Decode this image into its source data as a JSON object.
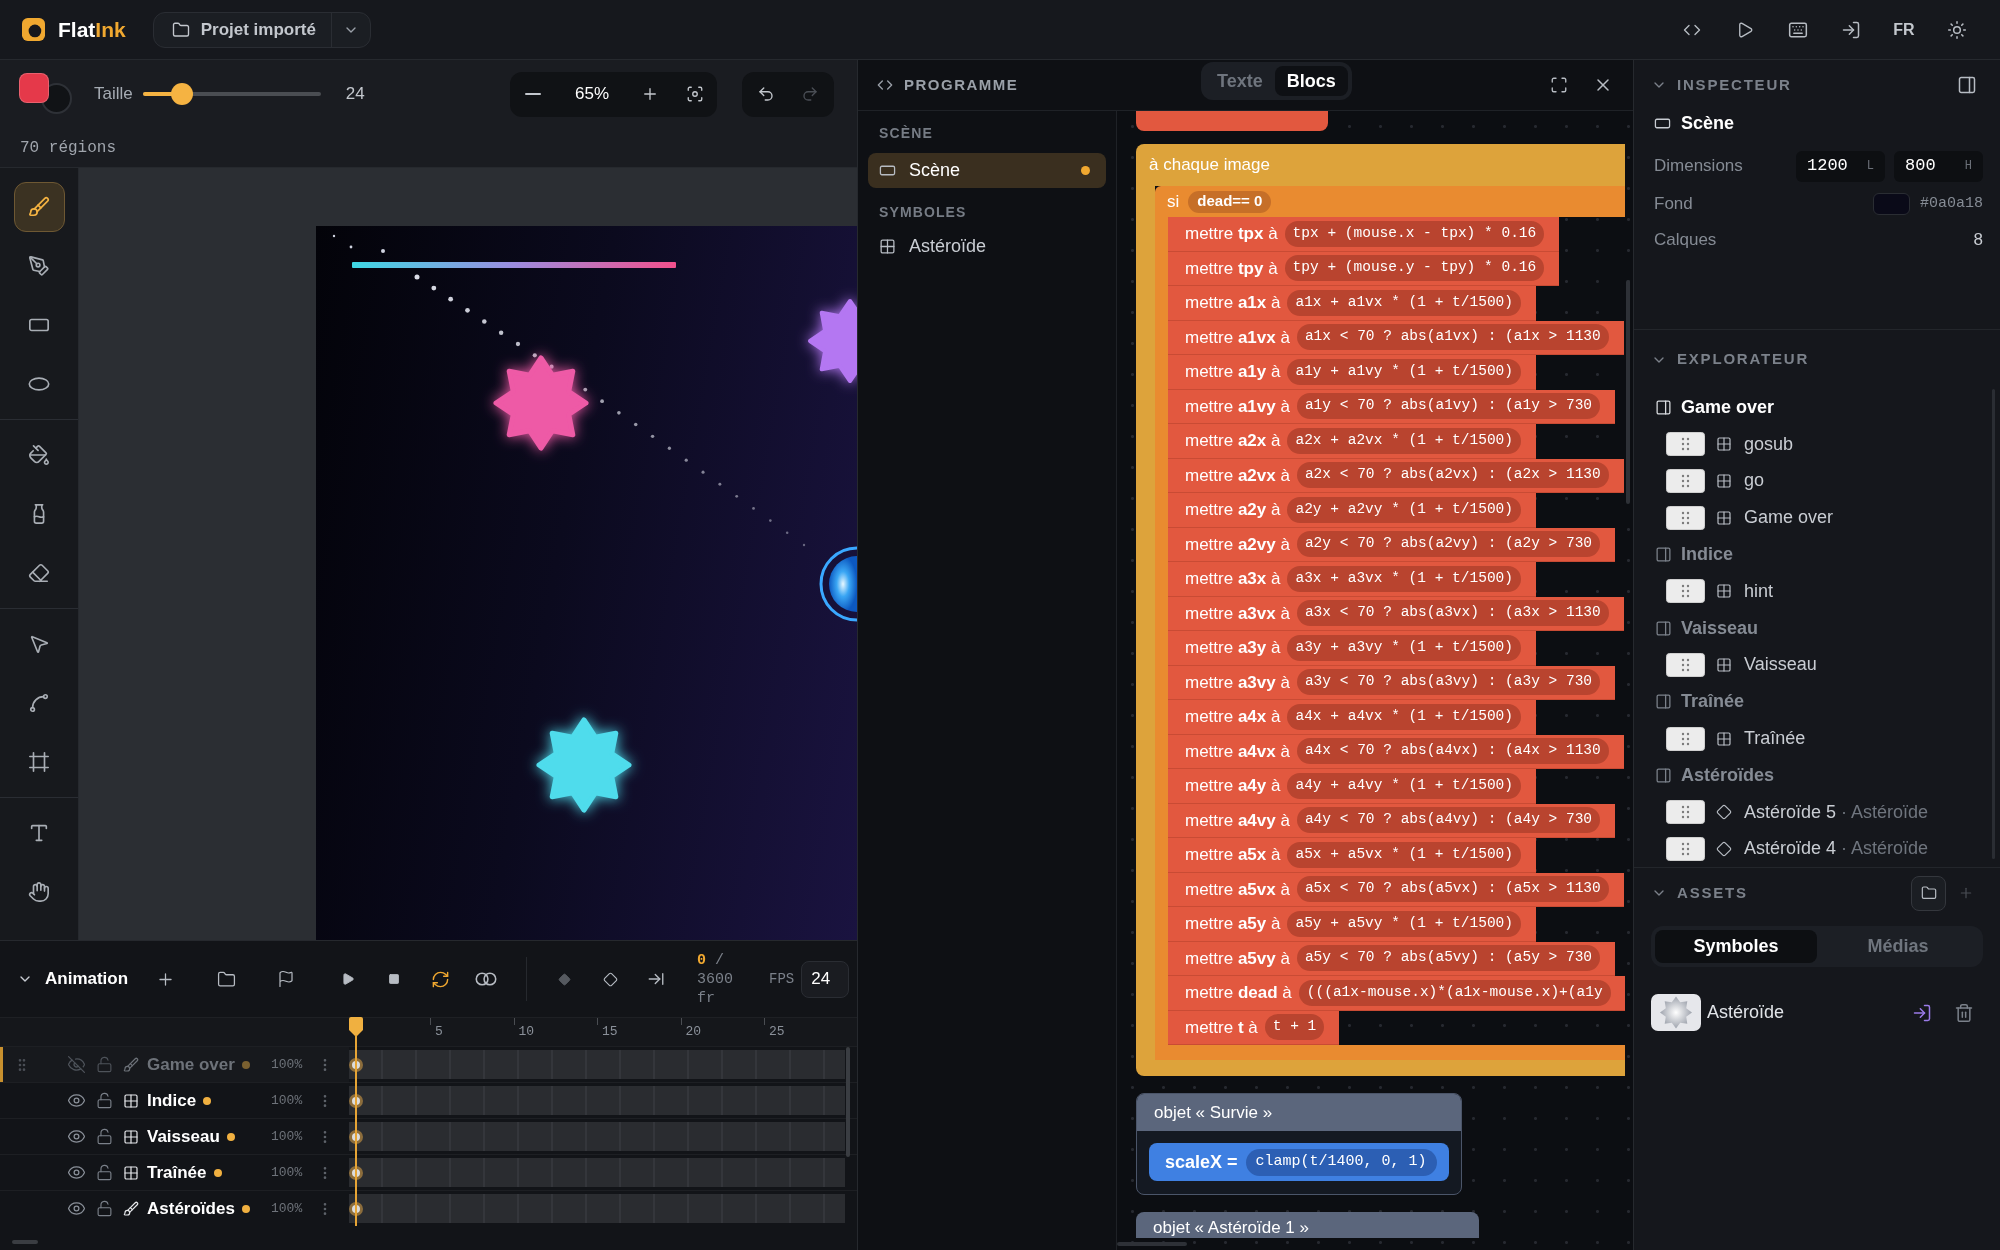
{
  "header": {
    "logo": {
      "text_1": "Flat",
      "text_2": "Ink"
    },
    "project": "Projet importé",
    "language": "FR"
  },
  "toolbar": {
    "color": "#e5394a",
    "size_label": "Taille",
    "size": {
      "level": 0.22
    },
    "size_value": "24",
    "zoom": "65%",
    "redo_disabled": true
  },
  "status": "70 régions",
  "tool_groups": [
    {
      "tools": [
        {
          "kind": "brush",
          "selected": true
        },
        {
          "kind": "pen",
          "selected": false
        },
        {
          "kind": "rectangle",
          "selected": false
        },
        {
          "kind": "ellipse",
          "selected": false
        }
      ]
    },
    {
      "tools": [
        {
          "kind": "bucket",
          "selected": false
        },
        {
          "kind": "bottle",
          "selected": false
        },
        {
          "kind": "eraser",
          "selected": false
        }
      ]
    },
    {
      "tools": [
        {
          "kind": "pointer",
          "selected": false
        },
        {
          "kind": "node",
          "selected": false
        },
        {
          "kind": "frame",
          "selected": false
        }
      ]
    },
    {
      "tools": [
        {
          "kind": "text",
          "selected": false
        },
        {
          "kind": "hand",
          "selected": false
        }
      ]
    }
  ],
  "timeline": {
    "title": "Animation",
    "loop": true,
    "frame": "0",
    "frame_total": "/ 3600 fr",
    "fps_label": "FPS",
    "fps": "24",
    "ruler": [
      "5",
      "10",
      "15",
      "20",
      "25"
    ],
    "layers": [
      {
        "name": "Game over",
        "kind": "brush",
        "visible": false,
        "selected": true,
        "opacity": "100%"
      },
      {
        "name": "Indice",
        "kind": "symbol",
        "visible": true,
        "selected": false,
        "opacity": "100%"
      },
      {
        "name": "Vaisseau",
        "kind": "symbol",
        "visible": true,
        "selected": false,
        "opacity": "100%"
      },
      {
        "name": "Traînée",
        "kind": "symbol",
        "visible": true,
        "selected": false,
        "opacity": "100%"
      },
      {
        "name": "Astéroïdes",
        "kind": "brush",
        "visible": true,
        "selected": false,
        "opacity": "100%"
      }
    ]
  },
  "program": {
    "title": "PROGRAMME",
    "tabs": [
      {
        "label": "Texte",
        "selected": false
      },
      {
        "label": "Blocs",
        "selected": true
      }
    ],
    "sections": [
      {
        "heading": "SCÈNE",
        "items": [
          {
            "label": "Scène",
            "kind": "scene",
            "selected": true,
            "modified": true
          }
        ]
      },
      {
        "heading": "SYMBOLES",
        "items": [
          {
            "label": "Astéroïde",
            "kind": "symbol",
            "selected": false,
            "modified": false
          }
        ]
      }
    ],
    "event": {
      "label": "à chaque image",
      "condition": {
        "label": "si",
        "expression": "dead== 0",
        "statements": [
          {
            "label": "mettre **tpx** à",
            "expression": "tpx + (mouse.x - tpx) * 0.16"
          },
          {
            "label": "mettre **tpy** à",
            "expression": "tpy + (mouse.y - tpy) * 0.16"
          },
          {
            "label": "mettre **a1x** à",
            "expression": "a1x + a1vx * (1 + t/1500)"
          },
          {
            "label": "mettre **a1vx** à",
            "expression": "a1x < 70 ? abs(a1vx) : (a1x > 1130"
          },
          {
            "label": "mettre **a1y** à",
            "expression": "a1y + a1vy * (1 + t/1500)"
          },
          {
            "label": "mettre **a1vy** à",
            "expression": "a1y < 70 ? abs(a1vy) : (a1y > 730"
          },
          {
            "label": "mettre **a2x** à",
            "expression": "a2x + a2vx * (1 + t/1500)"
          },
          {
            "label": "mettre **a2vx** à",
            "expression": "a2x < 70 ? abs(a2vx) : (a2x > 1130"
          },
          {
            "label": "mettre **a2y** à",
            "expression": "a2y + a2vy * (1 + t/1500)"
          },
          {
            "label": "mettre **a2vy** à",
            "expression": "a2y < 70 ? abs(a2vy) : (a2y > 730"
          },
          {
            "label": "mettre **a3x** à",
            "expression": "a3x + a3vx * (1 + t/1500)"
          },
          {
            "label": "mettre **a3vx** à",
            "expression": "a3x < 70 ? abs(a3vx) : (a3x > 1130"
          },
          {
            "label": "mettre **a3y** à",
            "expression": "a3y + a3vy * (1 + t/1500)"
          },
          {
            "label": "mettre **a3vy** à",
            "expression": "a3y < 70 ? abs(a3vy) : (a3y > 730"
          },
          {
            "label": "mettre **a4x** à",
            "expression": "a4x + a4vx * (1 + t/1500)"
          },
          {
            "label": "mettre **a4vx** à",
            "expression": "a4x < 70 ? abs(a4vx) : (a4x > 1130"
          },
          {
            "label": "mettre **a4y** à",
            "expression": "a4y + a4vy * (1 + t/1500)"
          },
          {
            "label": "mettre **a4vy** à",
            "expression": "a4y < 70 ? abs(a4vy) : (a4y > 730"
          },
          {
            "label": "mettre **a5x** à",
            "expression": "a5x + a5vx * (1 + t/1500)"
          },
          {
            "label": "mettre **a5vx** à",
            "expression": "a5x < 70 ? abs(a5vx) : (a5x > 1130"
          },
          {
            "label": "mettre **a5y** à",
            "expression": "a5y + a5vy * (1 + t/1500)"
          },
          {
            "label": "mettre **a5vy** à",
            "expression": "a5y < 70 ? abs(a5vy) : (a5y > 730"
          },
          {
            "label": "mettre **dead** à",
            "expression": "(((a1x-mouse.x)*(a1x-mouse.x)+(a1y"
          },
          {
            "label": "mettre **t** à",
            "expression": "t + 1"
          }
        ]
      }
    },
    "objects": [
      {
        "label": "objet « Survie »",
        "statements": [
          {
            "label": "scaleX =",
            "expression": "clamp(t/1400, 0, 1)"
          }
        ]
      },
      {
        "label": "objet « Astéroïde 1 »"
      }
    ]
  },
  "inspector": {
    "title": "INSPECTEUR",
    "selection": "Scène",
    "properties": [
      {
        "label": "Dimensions",
        "kind": "size",
        "fields": [
          {
            "value": "1200",
            "unit": "L"
          },
          {
            "value": "800",
            "unit": "H"
          }
        ]
      },
      {
        "label": "Fond",
        "kind": "color",
        "color": "#0a0a18",
        "value": "#0a0a18"
      },
      {
        "label": "Calques",
        "kind": "text",
        "value": "8"
      }
    ]
  },
  "explorer": {
    "title": "EXPLORATEUR",
    "layers": [
      {
        "label": "Game over",
        "selected": true,
        "children": [
          {
            "label": "gosub",
            "kind": "symbol"
          },
          {
            "label": "go",
            "kind": "symbol"
          },
          {
            "label": "Game over",
            "kind": "symbol"
          }
        ]
      },
      {
        "label": "Indice",
        "selected": false,
        "children": [
          {
            "label": "hint",
            "kind": "symbol"
          }
        ]
      },
      {
        "label": "Vaisseau",
        "selected": false,
        "children": [
          {
            "label": "Vaisseau",
            "kind": "symbol"
          }
        ]
      },
      {
        "label": "Traînée",
        "selected": false,
        "children": [
          {
            "label": "Traînée",
            "kind": "symbol"
          }
        ]
      },
      {
        "label": "Astéroïdes",
        "selected": false,
        "children": [
          {
            "label": "Astéroïde 5",
            "kind": "instance",
            "suffix": "· Astéroïde"
          },
          {
            "label": "Astéroïde 4",
            "kind": "instance",
            "suffix": "· Astéroïde"
          }
        ]
      }
    ]
  },
  "assets": {
    "title": "ASSETS",
    "tabs": [
      {
        "label": "Symboles",
        "selected": true
      },
      {
        "label": "Médias",
        "selected": false
      }
    ],
    "items": [
      {
        "label": "Astéroïde"
      }
    ]
  }
}
